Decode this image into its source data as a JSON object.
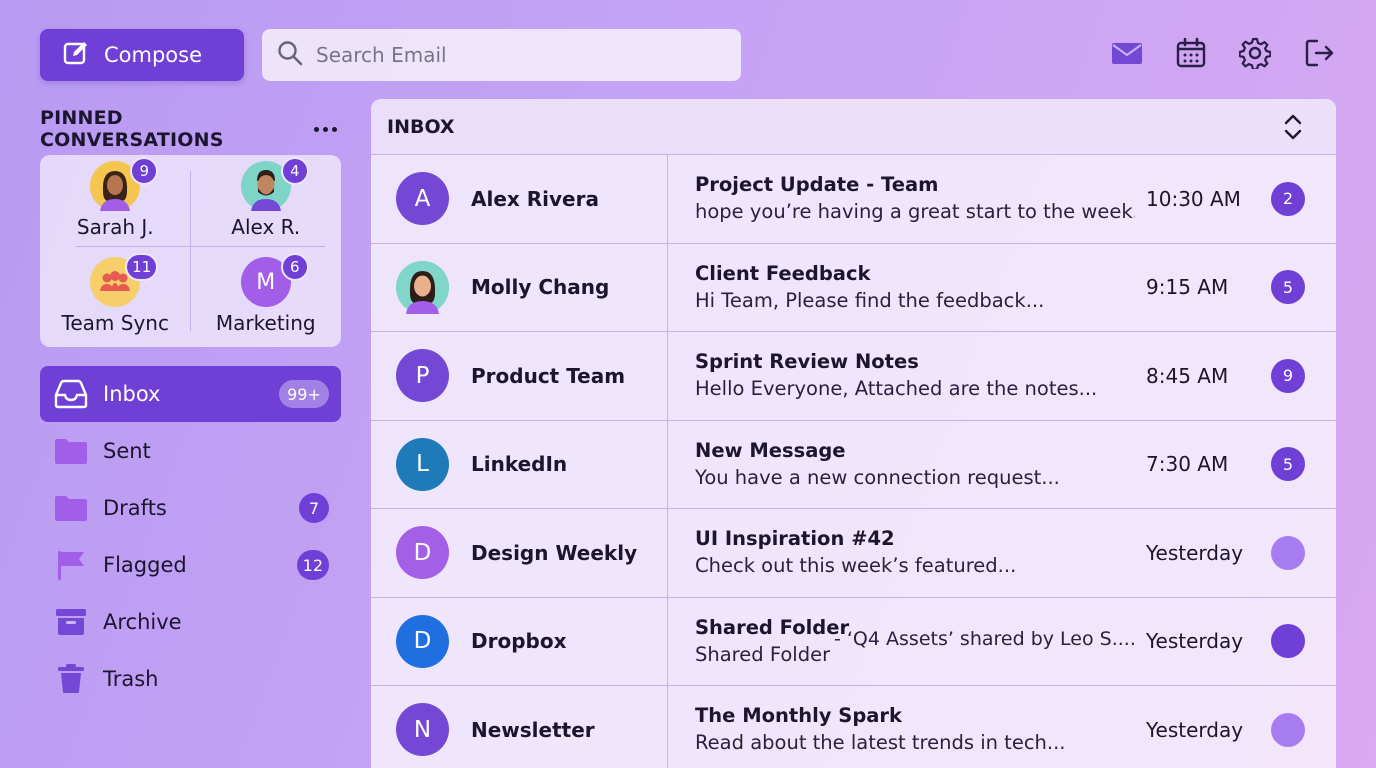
{
  "toolbar": {
    "compose_label": "Compose",
    "search_placeholder": "Search Email",
    "icons": [
      "mail-icon",
      "calendar-icon",
      "gear-icon",
      "logout-icon"
    ]
  },
  "colors": {
    "accent": "#6f3fd6",
    "accent_light": "#a77cf0",
    "background_start": "#b79bf2",
    "background_end": "#d9a9f2"
  },
  "pinned": {
    "title": "PINNED CONVERSATIONS",
    "items": [
      {
        "name": "Sarah J.",
        "count": "9"
      },
      {
        "name": "Alex R.",
        "count": "4"
      },
      {
        "name": "Team Sync",
        "count": "11"
      },
      {
        "name": "Marketing",
        "count": "6",
        "initial": "M"
      }
    ]
  },
  "folders": [
    {
      "label": "Inbox",
      "badge": "99+",
      "active": true
    },
    {
      "label": "Sent",
      "badge": ""
    },
    {
      "label": "Drafts",
      "badge": "7"
    },
    {
      "label": "Flagged",
      "badge": "12"
    },
    {
      "label": "Archive",
      "badge": ""
    },
    {
      "label": "Trash",
      "badge": ""
    }
  ],
  "inbox": {
    "title": "INBOX",
    "emails": [
      {
        "initial": "A",
        "sender": "Alex Rivera",
        "subject": "Project Update - Team",
        "preview": "hope you’re having a great start to the week...",
        "time": "10:30 AM",
        "badge": "2",
        "avatar_color": "#7448d4"
      },
      {
        "initial": "",
        "sender": "Molly Chang",
        "subject": "Client Feedback",
        "preview": "Hi Team, Please find the feedback...",
        "time": "9:15 AM",
        "badge": "5",
        "avatar_color": "#6fd0c4"
      },
      {
        "initial": "P",
        "sender": "Product Team",
        "subject": "Sprint Review Notes",
        "preview": "Hello Everyone, Attached are the notes...",
        "time": "8:45 AM",
        "badge": "9",
        "avatar_color": "#7448d4"
      },
      {
        "initial": "L",
        "sender": "LinkedIn",
        "subject": "New Message",
        "preview": "You have a new connection request...",
        "time": "7:30 AM",
        "badge": "5",
        "avatar_color": "#1f7ab8"
      },
      {
        "initial": "D",
        "sender": "Design Weekly",
        "subject": "UI Inspiration #42",
        "preview": "Check out this week’s featured...",
        "time": "Yesterday",
        "badge": "",
        "avatar_color": "#a35fe6"
      },
      {
        "initial": "D",
        "sender": "Dropbox",
        "subject": "Shared Folder",
        "preview": "Shared Folder",
        "extra": "- ‘Q4 Assets’ shared by Leo S....",
        "time": "Yesterday",
        "badge": "",
        "avatar_color": "#1f6fe0"
      },
      {
        "initial": "N",
        "sender": "Newsletter",
        "subject": "The Monthly Spark",
        "preview": "Read about the latest trends in tech...",
        "time": "Yesterday",
        "badge": "",
        "avatar_color": "#7448d4"
      }
    ]
  }
}
